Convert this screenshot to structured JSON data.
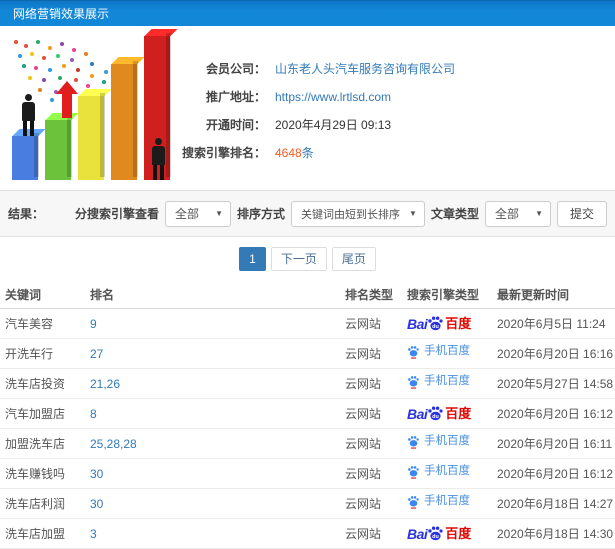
{
  "header": {
    "title": "网络营销效果展示"
  },
  "info": {
    "rows": [
      {
        "label": "会员公司：",
        "value": "山东老人头汽车服务咨询有限公司"
      },
      {
        "label": "推广地址：",
        "value": "https://www.lrtlsd.com"
      },
      {
        "label": "开通时间：",
        "value": "2020年4月29日 09:13"
      },
      {
        "label": "搜索引擎排名：",
        "value": "4648",
        "unit": "条"
      }
    ]
  },
  "filters": {
    "result_label": "结果：",
    "engine_view_label": "分搜索引擎查看",
    "engine_view_value": "全部",
    "sort_label": "排序方式",
    "sort_value": "关键词由短到长排序",
    "article_label": "文章类型",
    "article_value": "全部",
    "submit_label": "提交",
    "caret_icon": "▼"
  },
  "pagination": {
    "current": "1",
    "next_label": "下一页",
    "last_label": "尾页"
  },
  "table": {
    "headers": [
      "关键词",
      "排名",
      "排名类型",
      "搜索引擎类型",
      "最新更新时间"
    ],
    "engine_types": {
      "baidu": {
        "bai": "Bai",
        "du": "du",
        "cn": "百度"
      },
      "mobile_baidu": {
        "label": "手机百度"
      }
    },
    "rows": [
      {
        "keyword": "汽车美容",
        "rank": "9",
        "rank_type": "云网站",
        "engine": "baidu",
        "updated": "2020年6月5日 11:24"
      },
      {
        "keyword": "开洗车行",
        "rank": "27",
        "rank_type": "云网站",
        "engine": "mobile_baidu",
        "updated": "2020年6月20日 16:16"
      },
      {
        "keyword": "洗车店投资",
        "rank": "21,26",
        "rank_type": "云网站",
        "engine": "mobile_baidu",
        "updated": "2020年5月27日 14:58"
      },
      {
        "keyword": "汽车加盟店",
        "rank": "8",
        "rank_type": "云网站",
        "engine": "baidu",
        "updated": "2020年6月20日 16:12"
      },
      {
        "keyword": "加盟洗车店",
        "rank": "25,28,28",
        "rank_type": "云网站",
        "engine": "mobile_baidu",
        "updated": "2020年6月20日 16:11"
      },
      {
        "keyword": "洗车赚钱吗",
        "rank": "30",
        "rank_type": "云网站",
        "engine": "mobile_baidu",
        "updated": "2020年6月20日 16:12"
      },
      {
        "keyword": "洗车店利润",
        "rank": "30",
        "rank_type": "云网站",
        "engine": "mobile_baidu",
        "updated": "2020年6月18日 14:27"
      },
      {
        "keyword": "洗车店加盟",
        "rank": "3",
        "rank_type": "云网站",
        "engine": "baidu",
        "updated": "2020年6月18日 14:30"
      }
    ]
  },
  "colors": {
    "header_bg": "#1287d8",
    "link": "#337ab7",
    "rank_count": "#f15a24",
    "baidu_blue": "#2932e1",
    "baidu_red": "#e10602",
    "mobile_baidu_blue": "#4a90e2"
  }
}
